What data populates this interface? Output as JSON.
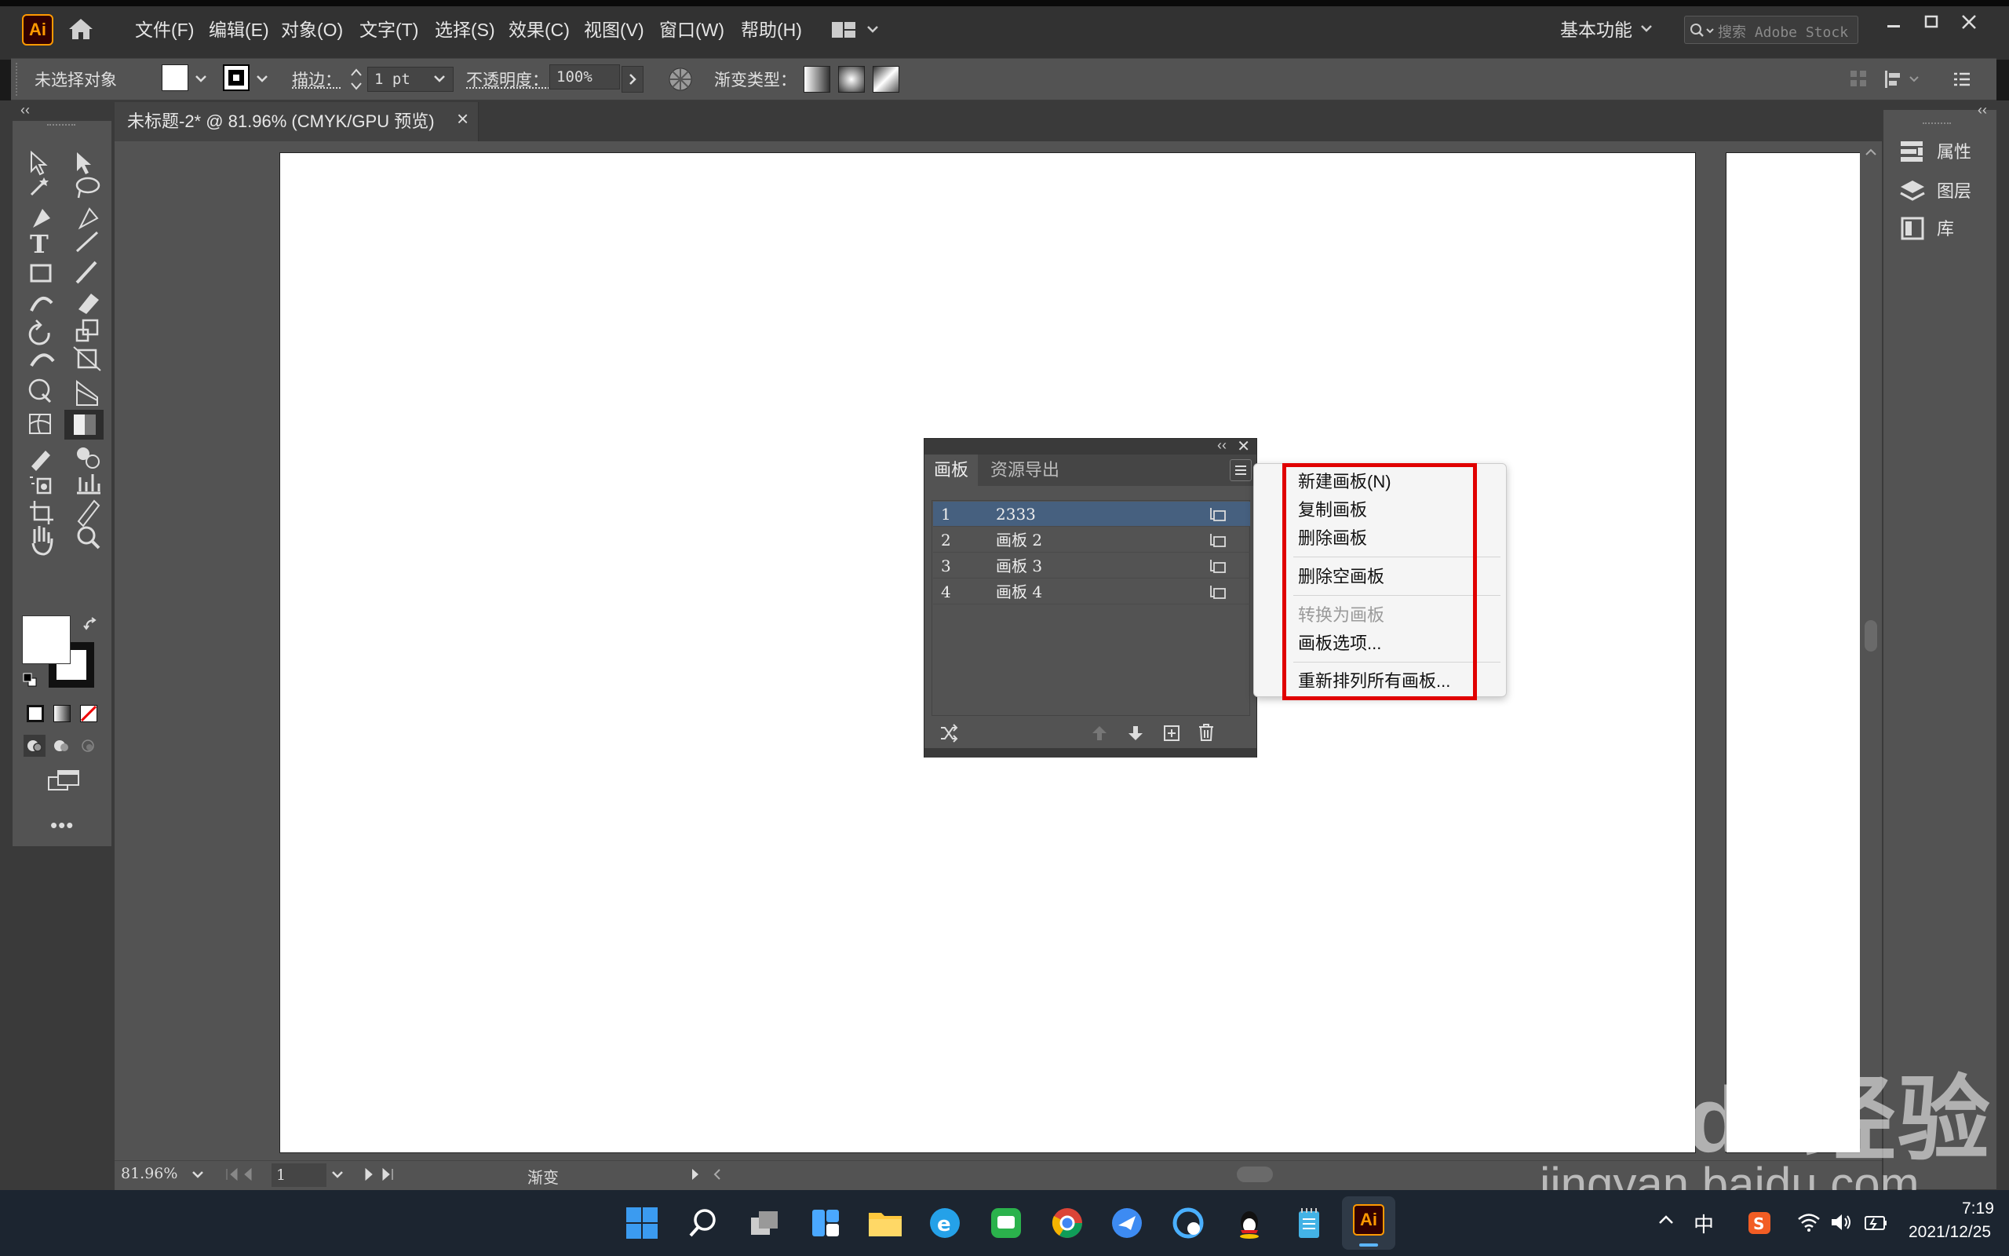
{
  "app": {
    "logo": "Ai"
  },
  "menu": [
    "文件(F)",
    "编辑(E)",
    "对象(O)",
    "文字(T)",
    "选择(S)",
    "效果(C)",
    "视图(V)",
    "窗口(W)",
    "帮助(H)"
  ],
  "workspace": "基本功能",
  "search_placeholder": "搜索 Adobe Stock",
  "control_bar": {
    "selection": "未选择对象",
    "stroke_label": "描边：",
    "stroke_value": "1 pt",
    "opacity_label": "不透明度：",
    "opacity_value": "100%",
    "gradient_type_label": "渐变类型："
  },
  "document_tab": {
    "title": "未标题-2* @ 81.96% (CMYK/GPU 预览)",
    "close": "×"
  },
  "right_panel": {
    "items": [
      "属性",
      "图层",
      "库"
    ]
  },
  "artboards_panel": {
    "tabs": [
      "画板",
      "资源导出"
    ],
    "rows": [
      {
        "num": "1",
        "name": "2333"
      },
      {
        "num": "2",
        "name": "画板 2"
      },
      {
        "num": "3",
        "name": "画板 3"
      },
      {
        "num": "4",
        "name": "画板 4"
      }
    ]
  },
  "context_menu": {
    "items": [
      "新建画板(N)",
      "复制画板",
      "删除画板",
      "删除空画板",
      "转换为画板",
      "画板选项...",
      "重新排列所有画板..."
    ]
  },
  "status_bar": {
    "zoom": "81.96%",
    "artboard": "1",
    "info": "渐变"
  },
  "taskbar": {
    "ime": "中",
    "time": "7:19",
    "date": "2021/12/25"
  },
  "watermark": {
    "brand": "Baidu经验",
    "url": "jingyan.baidu.com"
  },
  "colors": {
    "highlight_box": "#e00000",
    "selected_row": "#46607f",
    "ui_bg": "#535353"
  }
}
